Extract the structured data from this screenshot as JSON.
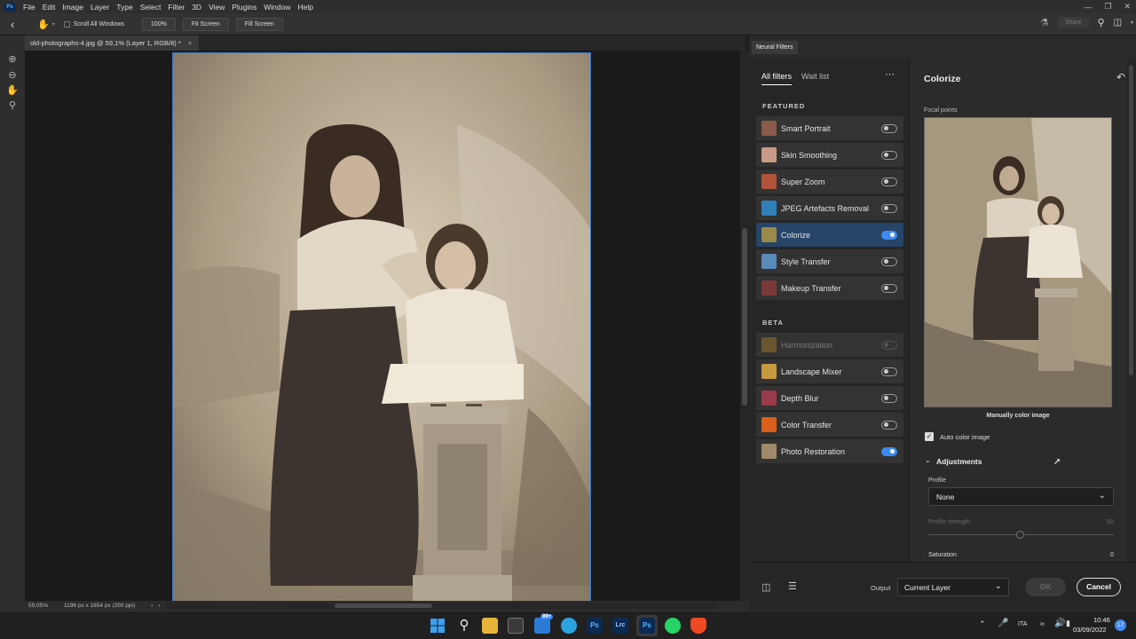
{
  "app": {
    "logo": "Ps"
  },
  "menu": [
    "File",
    "Edit",
    "Image",
    "Layer",
    "Type",
    "Select",
    "Filter",
    "3D",
    "View",
    "Plugins",
    "Window",
    "Help"
  ],
  "options": {
    "scroll_all": "Scroll All Windows",
    "zoom_btn": "100%",
    "fit_btn": "Fit Screen",
    "fill_btn": "Fill Screen",
    "share": "Share"
  },
  "document": {
    "tab_title": "old-photographs-4.jpg @ 59,1% (Layer 1, RGB/8) *"
  },
  "status": {
    "zoom": "59,05%",
    "dimensions": "1196 px x 1854 px (350 ppi)"
  },
  "panel": {
    "title": "Neural Filters"
  },
  "filters_tabs": {
    "all": "All filters",
    "wait": "Wait list"
  },
  "sections": {
    "featured": "FEATURED",
    "beta": "BETA"
  },
  "featured": [
    {
      "label": "Smart Portrait",
      "on": false,
      "disabled": false,
      "color": "#8a5a4a"
    },
    {
      "label": "Skin Smoothing",
      "on": false,
      "disabled": false,
      "color": "#c99a85"
    },
    {
      "label": "Super Zoom",
      "on": false,
      "disabled": false,
      "color": "#b0533a"
    },
    {
      "label": "JPEG Artefacts Removal",
      "on": false,
      "disabled": false,
      "color": "#2f7fb8"
    },
    {
      "label": "Colorize",
      "on": true,
      "disabled": false,
      "color": "#9a8a4a"
    },
    {
      "label": "Style Transfer",
      "on": false,
      "disabled": false,
      "color": "#5a8ab8"
    },
    {
      "label": "Makeup Transfer",
      "on": false,
      "disabled": false,
      "color": "#7a3a3a"
    }
  ],
  "beta": [
    {
      "label": "Harmonization",
      "on": false,
      "disabled": true,
      "color": "#a07a30"
    },
    {
      "label": "Landscape Mixer",
      "on": false,
      "disabled": false,
      "color": "#c89a40"
    },
    {
      "label": "Depth Blur",
      "on": false,
      "disabled": false,
      "color": "#9a3a4a"
    },
    {
      "label": "Color Transfer",
      "on": false,
      "disabled": false,
      "color": "#d8601a"
    },
    {
      "label": "Photo Restoration",
      "on": true,
      "disabled": false,
      "color": "#a08a6a"
    }
  ],
  "detail": {
    "title": "Colorize",
    "focal": "Focal points",
    "manual": "Manually color image",
    "auto": "Auto color image",
    "adjustments": "Adjustments",
    "profile_label": "Profile",
    "profile_value": "None",
    "strength_label": "Profile strength",
    "strength_value": "50",
    "saturation_label": "Saturation",
    "saturation_value": "0"
  },
  "footer": {
    "output_label": "Output",
    "output_value": "Current Layer",
    "ok": "OK",
    "cancel": "Cancel"
  },
  "tray": {
    "lang": "ITA",
    "time": "10:46",
    "date": "03/09/2022",
    "badge": "17",
    "mail_badge": "99+"
  },
  "taskbar_apps": [
    "Ps",
    "Lrc",
    "Ps"
  ]
}
